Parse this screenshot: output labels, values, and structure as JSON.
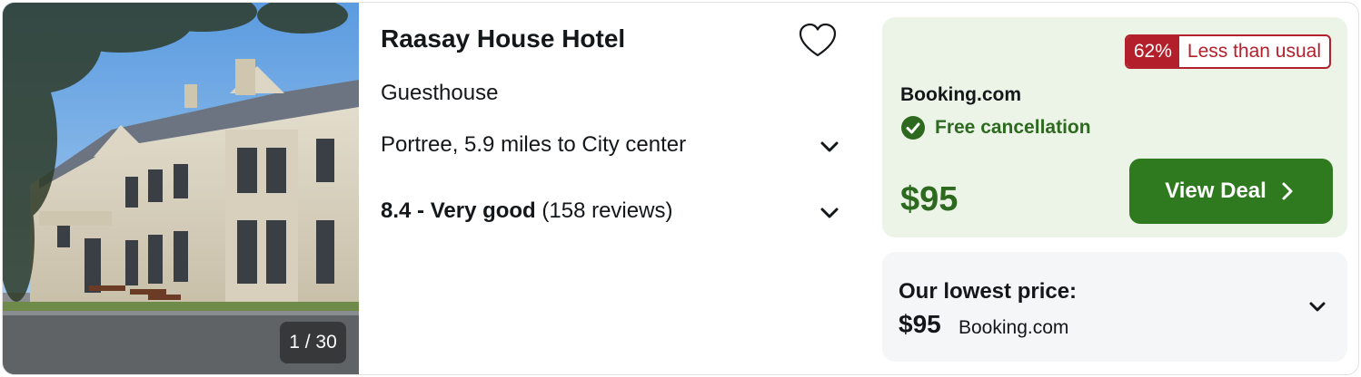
{
  "hotel": {
    "name": "Raasay House Hotel",
    "type": "Guesthouse",
    "location": "Portree, 5.9 miles to City center",
    "rating_score": "8.4 - Very good",
    "rating_reviews": "(158 reviews)",
    "photo_counter": "1 / 30",
    "favorite_icon": "heart-outline-icon"
  },
  "deal": {
    "discount_percent": "62%",
    "discount_label": "Less than usual",
    "provider": "Booking.com",
    "free_cancellation": "Free cancellation",
    "price": "$95",
    "button_label": "View Deal",
    "accent_color": "#2f7a1f",
    "badge_color": "#b3202b"
  },
  "lowest": {
    "title": "Our lowest price:",
    "price": "$95",
    "provider": "Booking.com"
  }
}
